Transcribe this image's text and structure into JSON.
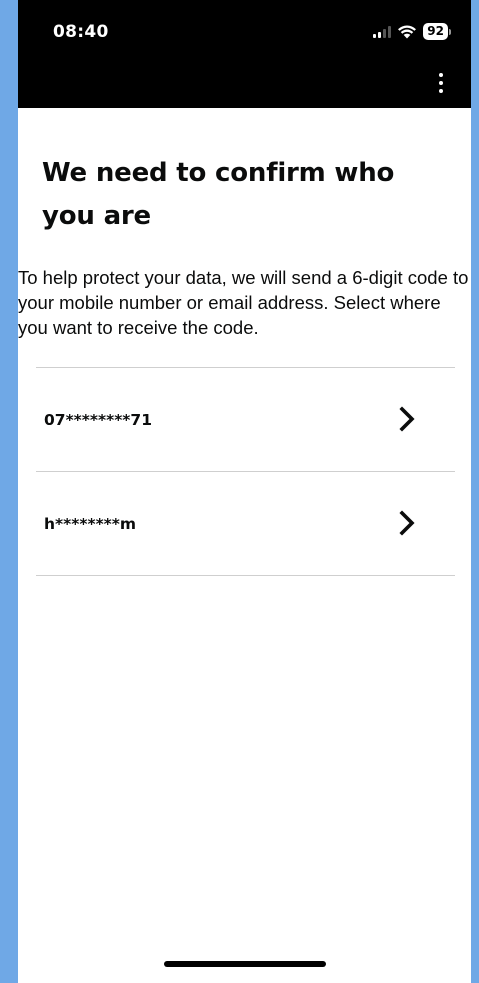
{
  "status_bar": {
    "time": "08:40",
    "battery_level": "92",
    "signal_icon": "signal-bars-icon",
    "wifi_icon": "wifi-icon"
  },
  "header": {
    "menu_icon": "more-vertical-icon"
  },
  "page": {
    "title": "We need to confirm who you are",
    "intro": "To help protect your data, we will send a 6-digit code to your mobile number or email address. Select where you want to receive the code."
  },
  "options": [
    {
      "label": "07********71",
      "icon": "chevron-right-icon"
    },
    {
      "label": "h********m",
      "icon": "chevron-right-icon"
    }
  ],
  "colors": {
    "background": "#6fa8e6",
    "header": "#000000",
    "text": "#0b0c0c",
    "divider": "#cfcfcf"
  }
}
